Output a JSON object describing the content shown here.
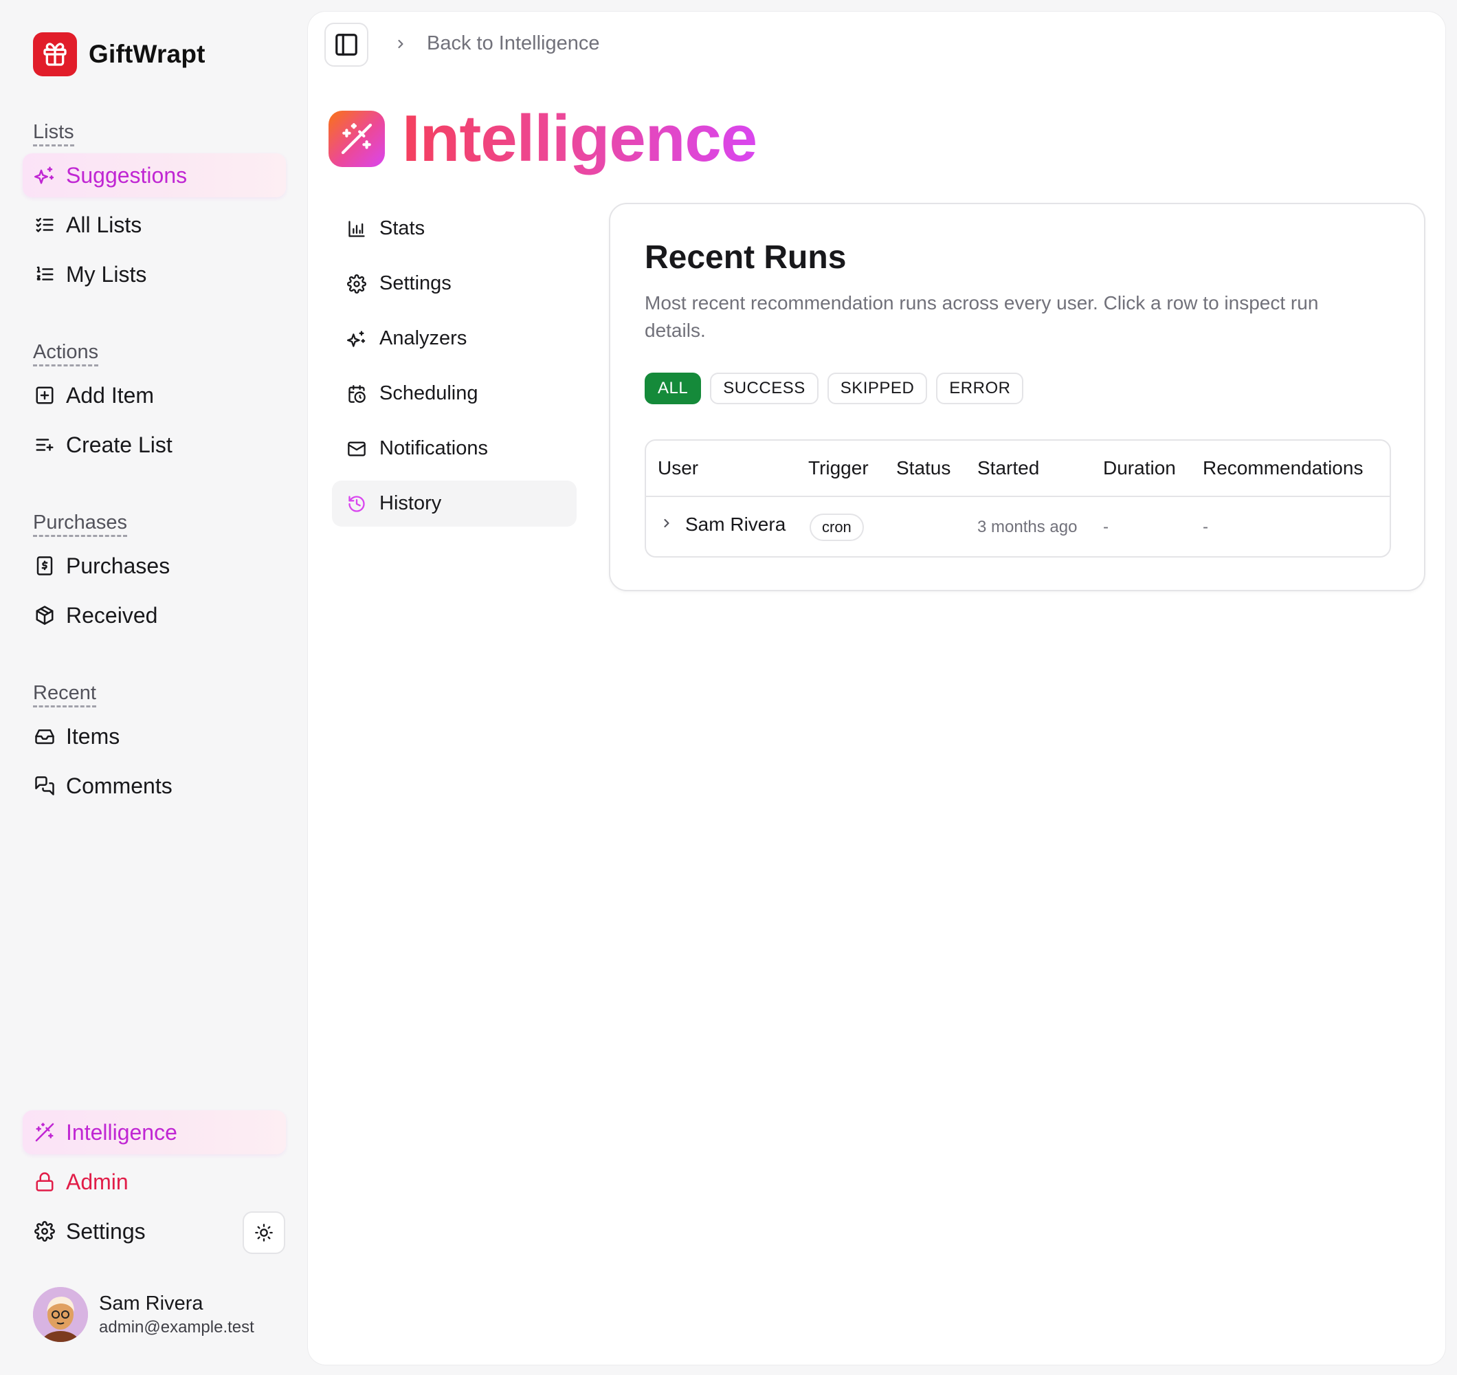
{
  "brand": {
    "name": "GiftWrapt",
    "color": "#e11d2a"
  },
  "sidebar": {
    "groups": {
      "lists": "Lists",
      "actions": "Actions",
      "purchases": "Purchases",
      "recent": "Recent"
    },
    "items": {
      "suggestions": "Suggestions",
      "all_lists": "All Lists",
      "my_lists": "My Lists",
      "add_item": "Add Item",
      "create_list": "Create List",
      "purchases": "Purchases",
      "received": "Received",
      "items": "Items",
      "comments": "Comments",
      "intelligence": "Intelligence",
      "admin": "Admin",
      "settings": "Settings"
    },
    "active_item": "suggestions"
  },
  "user": {
    "name": "Sam Rivera",
    "email": "admin@example.test"
  },
  "header": {
    "breadcrumb": "Back to Intelligence"
  },
  "page": {
    "title": "Intelligence"
  },
  "subnav": {
    "stats": "Stats",
    "settings": "Settings",
    "analyzers": "Analyzers",
    "scheduling": "Scheduling",
    "notifications": "Notifications",
    "history": "History",
    "active": "history"
  },
  "card": {
    "title": "Recent Runs",
    "description": "Most recent recommendation runs across every user. Click a row to inspect run details.",
    "filters": [
      "ALL",
      "SUCCESS",
      "SKIPPED",
      "ERROR"
    ],
    "active_filter": "ALL",
    "table": {
      "columns": [
        "User",
        "Trigger",
        "Status",
        "Started",
        "Duration",
        "Recommendations"
      ],
      "rows": [
        {
          "user": "Sam Rivera",
          "trigger": "cron",
          "status": "",
          "started": "3 months ago",
          "duration": "-",
          "recommendations": "-"
        }
      ]
    }
  },
  "colors": {
    "accent": "#c026d3",
    "admin": "#e11d48",
    "success": "#158a3a",
    "title_gradient": [
      "#f43f5e",
      "#ec4899",
      "#d946ef"
    ]
  }
}
